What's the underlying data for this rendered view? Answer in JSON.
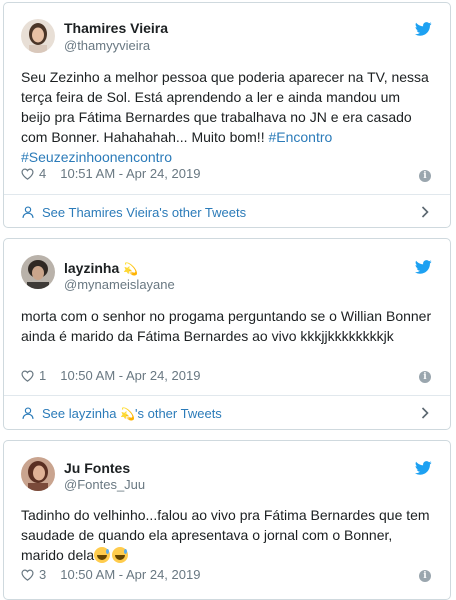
{
  "tweets": [
    {
      "name": "Thamires Vieira",
      "handle": "@thamyyvieira",
      "text_plain": "Seu Zezinho a melhor pessoa que poderia aparecer na TV, nessa terça feira de Sol. Está aprendendo a ler e ainda mandou um beijo pra Fátima Bernardes que trabalhava no JN e era casado com Bonner. Hahahahah... Muito bom!! ",
      "hashtag_1": "#Encontro",
      "hashtag_2": "#Seuzezinhoonencontro",
      "likes": "4",
      "timestamp": "10:51 AM - Apr 24, 2019",
      "see_more": "See Thamires Vieira's other Tweets"
    },
    {
      "name": "layzinha",
      "name_emoji": "💫",
      "handle": "@mynameislayane",
      "text_plain": "morta com o senhor no progama perguntando se o Willian Bonner ainda é marido da Fátima Bernardes ao vivo kkkjjkkkkkkkkjk",
      "likes": "1",
      "timestamp": "10:50 AM - Apr 24, 2019",
      "see_more_prefix": "See layzinha ",
      "see_more_emoji": "💫",
      "see_more_suffix": "'s other Tweets"
    },
    {
      "name": "Ju Fontes",
      "handle": "@Fontes_Juu",
      "text_plain": "Tadinho do velhinho...falou ao vivo pra Fátima Bernardes que tem saudade de quando ela apresentava o jornal com o Bonner, marido dela",
      "likes": "3",
      "timestamp": "10:50 AM - Apr 24, 2019"
    }
  ],
  "colors": {
    "link": "#2b7bb9",
    "twitter_blue": "#1da1f2",
    "muted": "#697882",
    "border": "#cfd9de"
  },
  "icons": {
    "brand": "twitter-bird-icon",
    "like": "heart-icon",
    "info": "info-icon",
    "profile": "person-icon",
    "more": "chevron-right-icon"
  }
}
